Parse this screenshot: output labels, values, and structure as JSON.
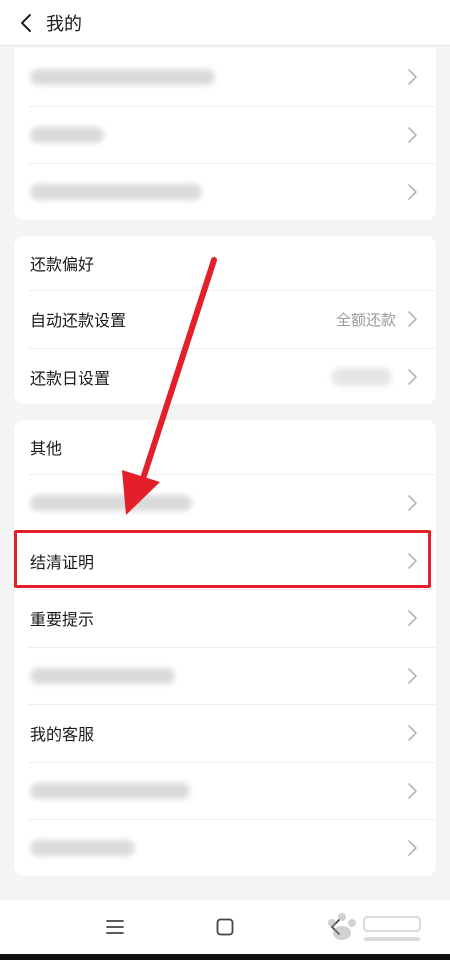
{
  "header": {
    "title": "我的",
    "back_icon": "chevron-left-icon"
  },
  "section_top": {
    "rows": [
      {
        "label": "",
        "blurred": true
      },
      {
        "label": "",
        "blurred": true
      },
      {
        "label": "",
        "blurred": true
      }
    ]
  },
  "section_repayment": {
    "title": "还款偏好",
    "rows": [
      {
        "label": "自动还款设置",
        "value": "全额还款"
      },
      {
        "label": "还款日设置",
        "value": ""
      }
    ]
  },
  "section_other": {
    "title": "其他",
    "rows": [
      {
        "label": "",
        "blurred": true
      },
      {
        "label": "结清证明"
      },
      {
        "label": "重要提示"
      },
      {
        "label": "",
        "blurred": true
      },
      {
        "label": "我的客服"
      },
      {
        "label": "",
        "blurred": true
      },
      {
        "label": "",
        "blurred": true
      }
    ]
  },
  "annotation": {
    "highlight_color": "#e3202a",
    "arrow_color": "#e3202a"
  },
  "navbar": {
    "icons": [
      "menu-icon",
      "home-square-icon",
      "back-icon"
    ]
  },
  "colors": {
    "background": "#f4f4f4",
    "card": "#ffffff",
    "secondary_text": "#9a9a9a"
  }
}
